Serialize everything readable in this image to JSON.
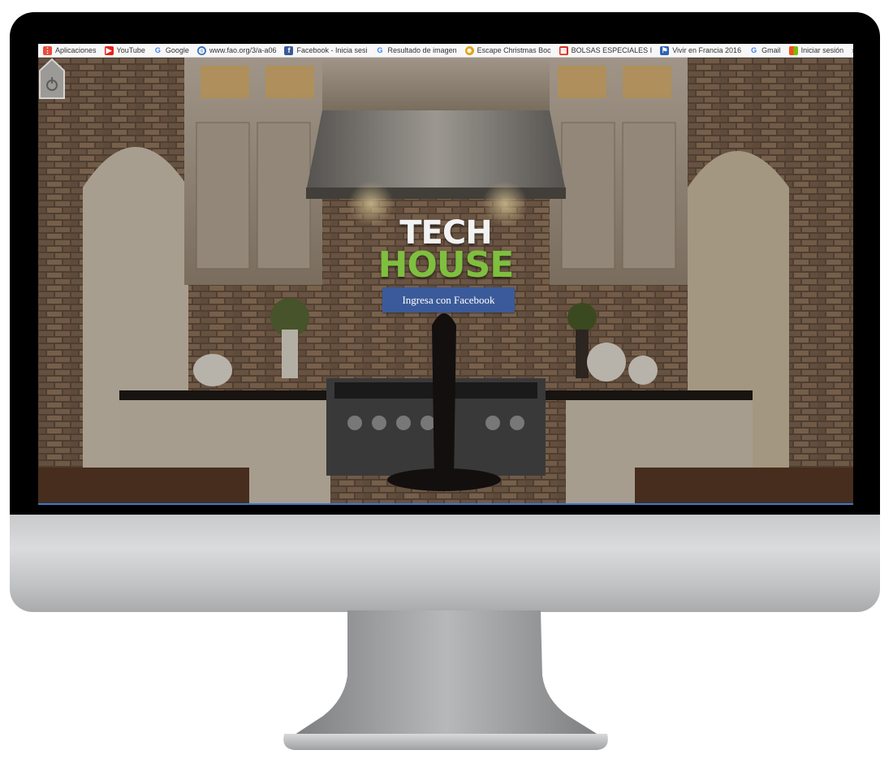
{
  "bookmarks": [
    {
      "label": "Aplicaciones",
      "icon": "apps-grid-icon",
      "color": "#e84c3d"
    },
    {
      "label": "YouTube",
      "icon": "youtube-icon",
      "color": "#e62117"
    },
    {
      "label": "Google",
      "icon": "google-icon",
      "color": "#4285f4"
    },
    {
      "label": "www.fao.org/3/a-a06",
      "icon": "globe-icon",
      "color": "#3a6fb7"
    },
    {
      "label": "Facebook - Inicia sesi",
      "icon": "facebook-icon",
      "color": "#3b5998"
    },
    {
      "label": "Resultado de imagen",
      "icon": "google-icon",
      "color": "#4285f4"
    },
    {
      "label": "Escape Christmas Boc",
      "icon": "gift-icon",
      "color": "#e0a41a"
    },
    {
      "label": "BOLSAS ESPECIALES I",
      "icon": "grid-icon",
      "color": "#d7301f"
    },
    {
      "label": "Vivir en Francia 2016",
      "icon": "flag-icon",
      "color": "#2c64b5"
    },
    {
      "label": "Gmail",
      "icon": "google-icon",
      "color": "#4285f4"
    },
    {
      "label": "Iniciar sesión",
      "icon": "microsoft-icon",
      "color": "#f3a21b"
    }
  ],
  "bookmarks_more": "»",
  "logo": {
    "line1": "TECH",
    "line2": "HOUSE",
    "line1_color": "#f2f2f2",
    "line2_color": "#7fbf3f"
  },
  "login_button": {
    "label": "Ingresa con Facebook",
    "color": "#3b5a9a"
  },
  "accent_line_color": "#3d79c8"
}
